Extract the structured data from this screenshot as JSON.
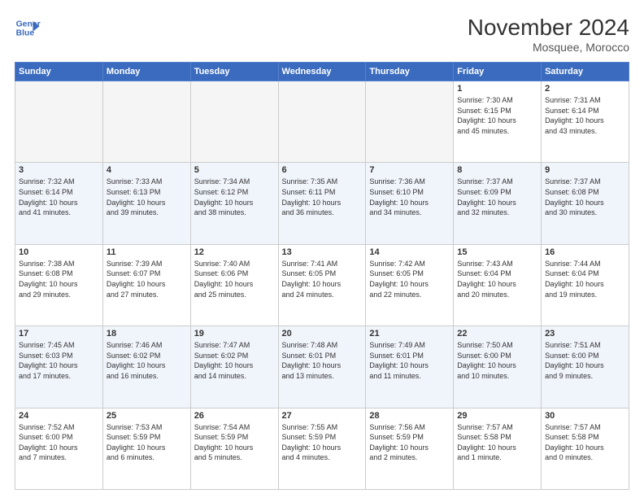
{
  "header": {
    "logo_line1": "General",
    "logo_line2": "Blue",
    "month_title": "November 2024",
    "location": "Mosquee, Morocco"
  },
  "days_of_week": [
    "Sunday",
    "Monday",
    "Tuesday",
    "Wednesday",
    "Thursday",
    "Friday",
    "Saturday"
  ],
  "weeks": [
    [
      {
        "num": "",
        "info": ""
      },
      {
        "num": "",
        "info": ""
      },
      {
        "num": "",
        "info": ""
      },
      {
        "num": "",
        "info": ""
      },
      {
        "num": "",
        "info": ""
      },
      {
        "num": "1",
        "info": "Sunrise: 7:30 AM\nSunset: 6:15 PM\nDaylight: 10 hours\nand 45 minutes."
      },
      {
        "num": "2",
        "info": "Sunrise: 7:31 AM\nSunset: 6:14 PM\nDaylight: 10 hours\nand 43 minutes."
      }
    ],
    [
      {
        "num": "3",
        "info": "Sunrise: 7:32 AM\nSunset: 6:14 PM\nDaylight: 10 hours\nand 41 minutes."
      },
      {
        "num": "4",
        "info": "Sunrise: 7:33 AM\nSunset: 6:13 PM\nDaylight: 10 hours\nand 39 minutes."
      },
      {
        "num": "5",
        "info": "Sunrise: 7:34 AM\nSunset: 6:12 PM\nDaylight: 10 hours\nand 38 minutes."
      },
      {
        "num": "6",
        "info": "Sunrise: 7:35 AM\nSunset: 6:11 PM\nDaylight: 10 hours\nand 36 minutes."
      },
      {
        "num": "7",
        "info": "Sunrise: 7:36 AM\nSunset: 6:10 PM\nDaylight: 10 hours\nand 34 minutes."
      },
      {
        "num": "8",
        "info": "Sunrise: 7:37 AM\nSunset: 6:09 PM\nDaylight: 10 hours\nand 32 minutes."
      },
      {
        "num": "9",
        "info": "Sunrise: 7:37 AM\nSunset: 6:08 PM\nDaylight: 10 hours\nand 30 minutes."
      }
    ],
    [
      {
        "num": "10",
        "info": "Sunrise: 7:38 AM\nSunset: 6:08 PM\nDaylight: 10 hours\nand 29 minutes."
      },
      {
        "num": "11",
        "info": "Sunrise: 7:39 AM\nSunset: 6:07 PM\nDaylight: 10 hours\nand 27 minutes."
      },
      {
        "num": "12",
        "info": "Sunrise: 7:40 AM\nSunset: 6:06 PM\nDaylight: 10 hours\nand 25 minutes."
      },
      {
        "num": "13",
        "info": "Sunrise: 7:41 AM\nSunset: 6:05 PM\nDaylight: 10 hours\nand 24 minutes."
      },
      {
        "num": "14",
        "info": "Sunrise: 7:42 AM\nSunset: 6:05 PM\nDaylight: 10 hours\nand 22 minutes."
      },
      {
        "num": "15",
        "info": "Sunrise: 7:43 AM\nSunset: 6:04 PM\nDaylight: 10 hours\nand 20 minutes."
      },
      {
        "num": "16",
        "info": "Sunrise: 7:44 AM\nSunset: 6:04 PM\nDaylight: 10 hours\nand 19 minutes."
      }
    ],
    [
      {
        "num": "17",
        "info": "Sunrise: 7:45 AM\nSunset: 6:03 PM\nDaylight: 10 hours\nand 17 minutes."
      },
      {
        "num": "18",
        "info": "Sunrise: 7:46 AM\nSunset: 6:02 PM\nDaylight: 10 hours\nand 16 minutes."
      },
      {
        "num": "19",
        "info": "Sunrise: 7:47 AM\nSunset: 6:02 PM\nDaylight: 10 hours\nand 14 minutes."
      },
      {
        "num": "20",
        "info": "Sunrise: 7:48 AM\nSunset: 6:01 PM\nDaylight: 10 hours\nand 13 minutes."
      },
      {
        "num": "21",
        "info": "Sunrise: 7:49 AM\nSunset: 6:01 PM\nDaylight: 10 hours\nand 11 minutes."
      },
      {
        "num": "22",
        "info": "Sunrise: 7:50 AM\nSunset: 6:00 PM\nDaylight: 10 hours\nand 10 minutes."
      },
      {
        "num": "23",
        "info": "Sunrise: 7:51 AM\nSunset: 6:00 PM\nDaylight: 10 hours\nand 9 minutes."
      }
    ],
    [
      {
        "num": "24",
        "info": "Sunrise: 7:52 AM\nSunset: 6:00 PM\nDaylight: 10 hours\nand 7 minutes."
      },
      {
        "num": "25",
        "info": "Sunrise: 7:53 AM\nSunset: 5:59 PM\nDaylight: 10 hours\nand 6 minutes."
      },
      {
        "num": "26",
        "info": "Sunrise: 7:54 AM\nSunset: 5:59 PM\nDaylight: 10 hours\nand 5 minutes."
      },
      {
        "num": "27",
        "info": "Sunrise: 7:55 AM\nSunset: 5:59 PM\nDaylight: 10 hours\nand 4 minutes."
      },
      {
        "num": "28",
        "info": "Sunrise: 7:56 AM\nSunset: 5:59 PM\nDaylight: 10 hours\nand 2 minutes."
      },
      {
        "num": "29",
        "info": "Sunrise: 7:57 AM\nSunset: 5:58 PM\nDaylight: 10 hours\nand 1 minute."
      },
      {
        "num": "30",
        "info": "Sunrise: 7:57 AM\nSunset: 5:58 PM\nDaylight: 10 hours\nand 0 minutes."
      }
    ]
  ]
}
